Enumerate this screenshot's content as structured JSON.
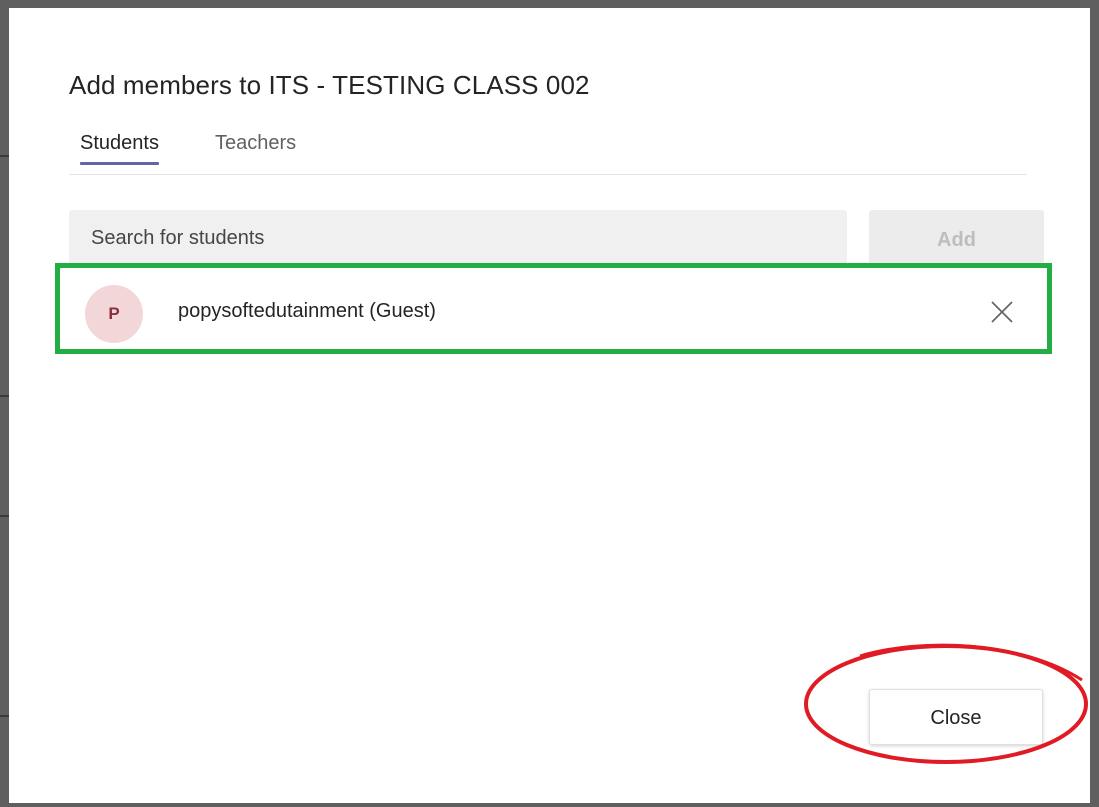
{
  "dialog": {
    "title": "Add members to ITS - TESTING CLASS 002"
  },
  "tabs": [
    {
      "label": "Students",
      "active": true
    },
    {
      "label": "Teachers",
      "active": false
    }
  ],
  "search": {
    "placeholder": "Search for students"
  },
  "add_button": {
    "label": "Add",
    "enabled": false
  },
  "selected_members": [
    {
      "initial": "P",
      "name": "popysoftedutainment (Guest)",
      "remove_icon": "close-icon"
    }
  ],
  "close_button": {
    "label": "Close"
  },
  "colors": {
    "accent": "#6264a7",
    "highlight_box": "#22ad45",
    "annotation_ellipse": "#e01b24",
    "avatar_bg": "#f3d6d8",
    "avatar_text": "#8a2f3c"
  }
}
